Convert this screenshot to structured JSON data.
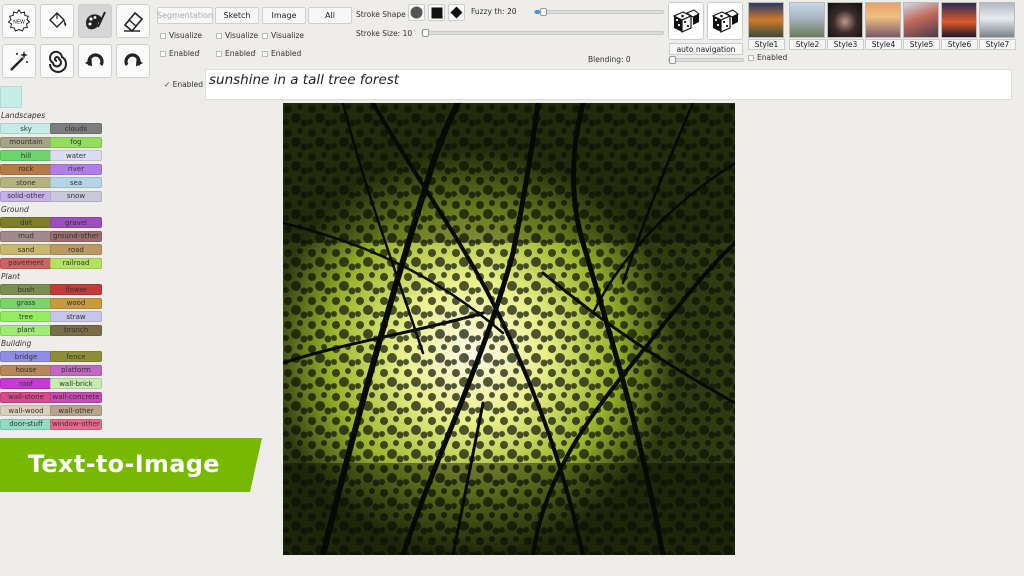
{
  "toolbar": {
    "tools": [
      {
        "name": "new-tool",
        "label": "NEW"
      },
      {
        "name": "fill-tool"
      },
      {
        "name": "palette-tool"
      },
      {
        "name": "eraser-tool"
      },
      {
        "name": "magic-wand-tool"
      },
      {
        "name": "swirl-tool"
      },
      {
        "name": "undo-tool"
      },
      {
        "name": "redo-tool"
      }
    ]
  },
  "selected_color": "#c5ece6",
  "label_groups": [
    {
      "title": "Landscapes",
      "items": [
        {
          "label": "sky",
          "color": "#c6ece6"
        },
        {
          "label": "clouds",
          "color": "#7d7d7d"
        },
        {
          "label": "mountain",
          "color": "#a3a386"
        },
        {
          "label": "fog",
          "color": "#92dd5d"
        },
        {
          "label": "hill",
          "color": "#6cd66c"
        },
        {
          "label": "water",
          "color": "#dcdcf2"
        },
        {
          "label": "rock",
          "color": "#b67a4a"
        },
        {
          "label": "river",
          "color": "#b07ee8"
        },
        {
          "label": "stone",
          "color": "#b3b380"
        },
        {
          "label": "sea",
          "color": "#b4d4ea"
        },
        {
          "label": "solid-other",
          "color": "#c5b0e8"
        },
        {
          "label": "snow",
          "color": "#c8c8d8"
        }
      ]
    },
    {
      "title": "Ground",
      "items": [
        {
          "label": "dirt",
          "color": "#7e7e28"
        },
        {
          "label": "gravel",
          "color": "#9c4ec0"
        },
        {
          "label": "mud",
          "color": "#a08a8a"
        },
        {
          "label": "ground-other",
          "color": "#9a6e6e"
        },
        {
          "label": "sand",
          "color": "#c8b86e"
        },
        {
          "label": "road",
          "color": "#b89a62"
        },
        {
          "label": "pavement",
          "color": "#d06262"
        },
        {
          "label": "railroad",
          "color": "#b5e25e"
        }
      ]
    },
    {
      "title": "Plant",
      "items": [
        {
          "label": "bush",
          "color": "#7a8e52"
        },
        {
          "label": "flower",
          "color": "#c43a3a"
        },
        {
          "label": "grass",
          "color": "#7cd466"
        },
        {
          "label": "wood",
          "color": "#c89a3a"
        },
        {
          "label": "tree",
          "color": "#92ee5e"
        },
        {
          "label": "straw",
          "color": "#c8c4ec"
        },
        {
          "label": "plant",
          "color": "#9eec72"
        },
        {
          "label": "branch",
          "color": "#7a6e48"
        }
      ]
    },
    {
      "title": "Building",
      "items": [
        {
          "label": "bridge",
          "color": "#8e8ee4"
        },
        {
          "label": "fence",
          "color": "#8e8e3a"
        },
        {
          "label": "house",
          "color": "#b8865a"
        },
        {
          "label": "platform",
          "color": "#c466c4"
        },
        {
          "label": "roof",
          "color": "#c83ad4"
        },
        {
          "label": "wall-brick",
          "color": "#c8ecb0"
        },
        {
          "label": "wall-stone",
          "color": "#d84a8a"
        },
        {
          "label": "wall-concrete",
          "color": "#c84ab4"
        },
        {
          "label": "wall-wood",
          "color": "#d8d0b8"
        },
        {
          "label": "wall-other",
          "color": "#b8a48e"
        },
        {
          "label": "door-stuff",
          "color": "#92dcc4"
        },
        {
          "label": "window-other",
          "color": "#e86a8a"
        }
      ]
    }
  ],
  "modes": {
    "segmentation": "Segmentation",
    "sketch": "Sketch",
    "image": "Image",
    "all": "All"
  },
  "checks": {
    "visualize": "Visualize",
    "enabled": "Enabled",
    "prompt_enabled": "✓ Enabled"
  },
  "stroke": {
    "shape_label": "Stroke Shape",
    "size_label": "Stroke Size: 10",
    "size_value": 10,
    "fuzzy_label": "Fuzzy th: 20",
    "fuzzy_value": 0.04,
    "blending_label": "Blending: 0",
    "blending_value": 0
  },
  "auto_navigation": "auto navigation",
  "styles": [
    {
      "label": "Style1"
    },
    {
      "label": "Style2"
    },
    {
      "label": "Style3"
    },
    {
      "label": "Style4"
    },
    {
      "label": "Style5"
    },
    {
      "label": "Style6"
    },
    {
      "label": "Style7"
    }
  ],
  "prompt": "sunshine in a tall tree forest",
  "banner": "Text-to-Image",
  "colors": {
    "banner": "#76b900",
    "accent": "#4a90d9"
  }
}
